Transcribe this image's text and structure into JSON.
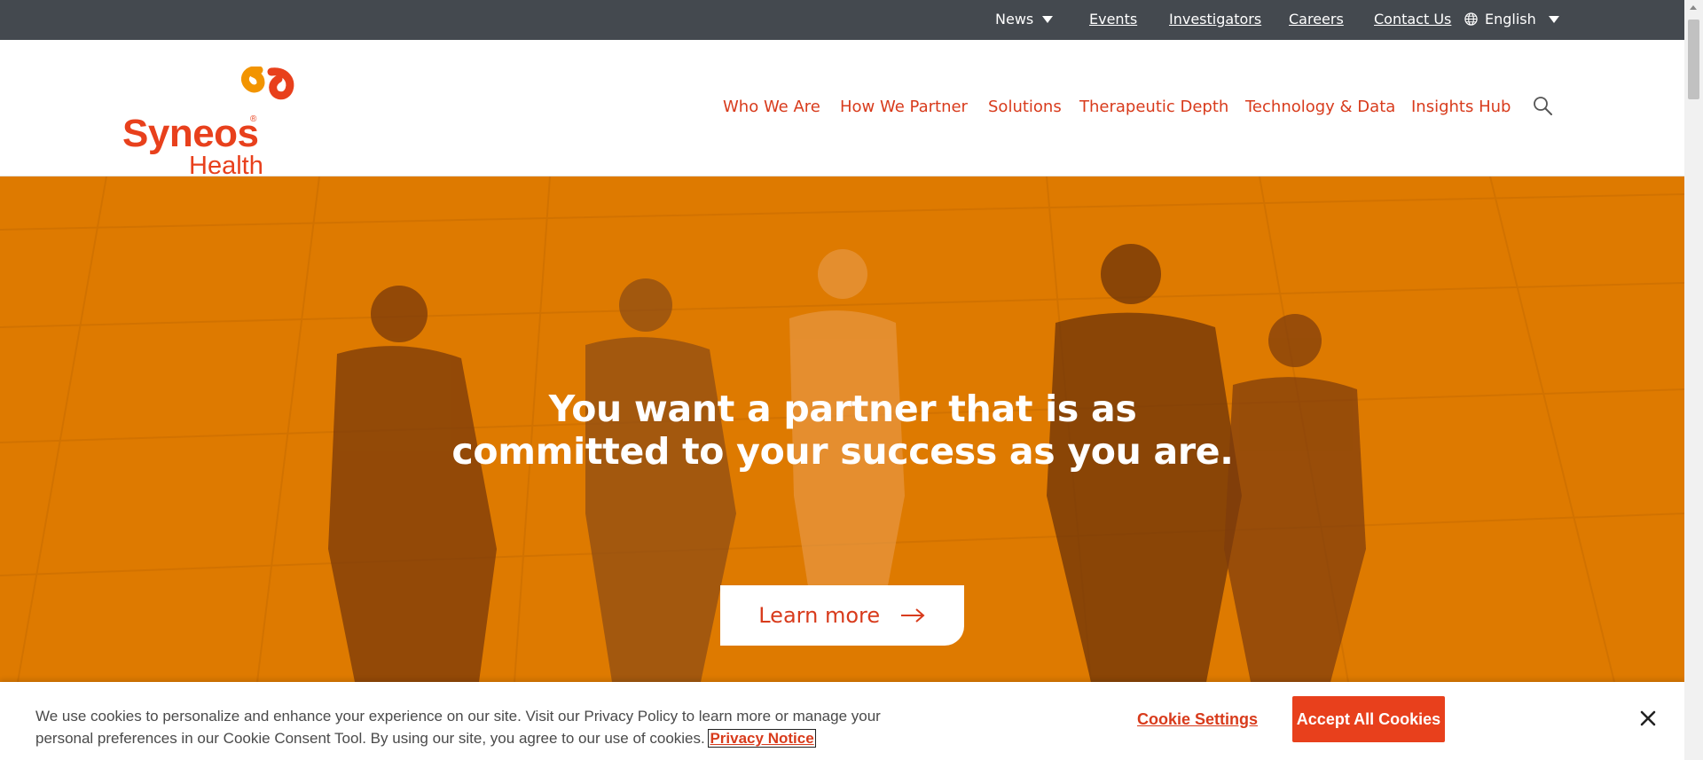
{
  "topbar": {
    "news": "News",
    "events": "Events",
    "investigators": "Investigators",
    "careers": "Careers",
    "contact": "Contact Us",
    "language": "English"
  },
  "logo": {
    "wordmark": "Syneos",
    "registered": "®",
    "sub": "Health"
  },
  "nav": {
    "items": [
      "Who We Are",
      "How We Partner",
      "Solutions",
      "Therapeutic Depth",
      "Technology & Data",
      "Insights Hub"
    ]
  },
  "hero": {
    "heading_line1": "You want a partner that is as",
    "heading_line2": "committed to your success as you are.",
    "cta": "Learn more"
  },
  "cookie": {
    "text": "We use cookies to personalize and enhance your experience on our site. Visit our Privacy Policy to learn more or manage your personal preferences in our Cookie Consent Tool. By using our site, you agree to our use of cookies.",
    "privacy_link": "Privacy Notice",
    "settings": "Cookie Settings",
    "accept": "Accept All Cookies"
  },
  "colors": {
    "brand": "#e8401c",
    "hero_bg": "#de7a00",
    "topbar_bg": "#44494f"
  },
  "icons": [
    "chevron-down-icon",
    "globe-icon",
    "search-icon",
    "arrow-right-icon",
    "close-icon"
  ]
}
